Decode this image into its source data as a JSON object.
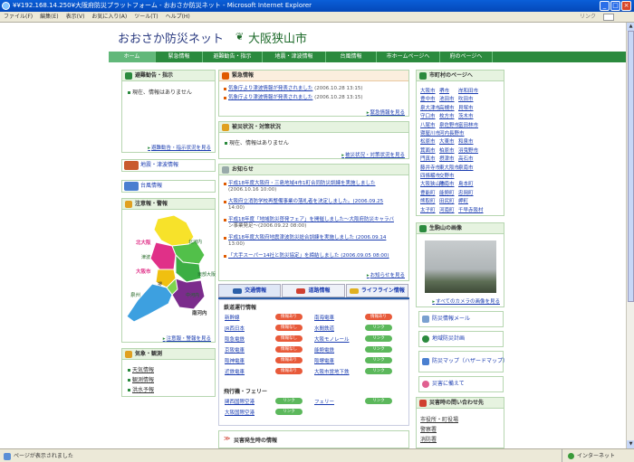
{
  "window": {
    "title": "¥¥192.168.14.250¥大阪府防災プラットフォーム - おおさか防災ネット - Microsoft Internet Explorer"
  },
  "menu": {
    "items": [
      "ファイル(F)",
      "編集(E)",
      "表示(V)",
      "お気に入り(A)",
      "ツール(T)",
      "ヘルプ(H)"
    ],
    "links": "リンク"
  },
  "status": {
    "text": "ページが表示されました",
    "zone": "インターネット"
  },
  "header": {
    "site_title": "おおさか防災ネット",
    "city": "大阪狭山市"
  },
  "nav": [
    "ホーム",
    "緊急情報",
    "避難勧告・指示",
    "地震・津波情報",
    "台風情報",
    "市ホームページへ",
    "府のページへ"
  ],
  "evac": {
    "title": "避難勧告・指示",
    "status": "現在、情報はありません",
    "more": "避難勧告・指示状況を見る"
  },
  "left_buttons": {
    "quake": "地震・津波情報",
    "typhoon": "台風情報"
  },
  "warn": {
    "title": "注意報・警報",
    "more": "注意報・警報を見る",
    "regions": {
      "hokutai": "北大阪",
      "higashi": "東部大阪",
      "kawachi": "北河内",
      "naka": "中河内",
      "minami": "南河内",
      "senshu": "泉州",
      "osaka": "大阪市",
      "sakai": "堺",
      "tsunami": "津波"
    }
  },
  "weather": {
    "title": "気象・観測",
    "items": [
      "天気情報",
      "観測情報",
      "洪水予報"
    ]
  },
  "emergency": {
    "title": "緊急情報",
    "items": [
      {
        "text": "気象庁より津波情報が発表されました",
        "date": "(2006.10.28 13:15)"
      },
      {
        "text": "気象庁より津波情報が発表されました",
        "date": "(2006.10.28 13:15)"
      }
    ],
    "more": "緊急情報を見る"
  },
  "damage": {
    "title": "被災状況・対策状況",
    "status": "現在、情報はありません",
    "more": "被災状況・対策状況を見る"
  },
  "notice": {
    "title": "お知らせ",
    "items": [
      {
        "lines": [
          "平成18年度大阪府・三島地域4市1町合同防災訓練を実施しました",
          "(2006.10.16 10:00)"
        ]
      },
      {
        "lines": [
          "大阪府立消防学校再整備事業の落札者を決定しました。(2006.09.25",
          "14:00)"
        ]
      },
      {
        "lines": [
          "平成18年度「地域防災啓発フェア」を開催しました〜大阪府防災キャラバ",
          "ン事業発足〜(2006.09.22 08:00)"
        ]
      },
      {
        "lines": [
          "平成18年度大阪府地震津波防災総合訓練を実施しました (2006.09.14",
          "13:00)"
        ]
      },
      {
        "lines": [
          "「大手スーパー14社と防災協定」を締結しました (2006.09.05 08:00)"
        ]
      }
    ],
    "more": "お知らせを見る"
  },
  "traffic": {
    "tabs": [
      "交通情報",
      "道路情報",
      "ライフライン情報"
    ],
    "rail_title": "鉄道運行情報",
    "rail_left": [
      {
        "name": "新幹線",
        "badge": "情報あり",
        "state": "red"
      },
      {
        "name": "JR西日本",
        "badge": "情報なし",
        "state": "red"
      },
      {
        "name": "阪急電鉄",
        "badge": "情報なし",
        "state": "red"
      },
      {
        "name": "京阪電車",
        "badge": "情報なし",
        "state": "red"
      },
      {
        "name": "阪神電車",
        "badge": "情報あり",
        "state": "red"
      },
      {
        "name": "近鉄電車",
        "badge": "情報あり",
        "state": "red"
      }
    ],
    "rail_right": [
      {
        "name": "南海電車",
        "badge": "情報あり",
        "state": "red"
      },
      {
        "name": "水間鉄道",
        "badge": "リンク",
        "state": "green"
      },
      {
        "name": "大阪モノレール",
        "badge": "リンク",
        "state": "green"
      },
      {
        "name": "能勢電鉄",
        "badge": "リンク",
        "state": "green"
      },
      {
        "name": "阪堺電車",
        "badge": "リンク",
        "state": "green"
      },
      {
        "name": "大阪市営地下鉄",
        "badge": "リンク",
        "state": "green"
      }
    ],
    "air_title": "飛行機・フェリー",
    "air_left": [
      {
        "name": "関西国際空港",
        "badge": "リンク"
      },
      {
        "name": "大阪国際空港",
        "badge": "リンク"
      }
    ],
    "air_right": [
      {
        "name": "フェリー",
        "badge": "リンク"
      }
    ]
  },
  "disaster_link": "災害発生時の情報",
  "cities": {
    "title": "市町村のページへ",
    "rows": [
      [
        "大阪市",
        "堺市",
        "岸和田市"
      ],
      [
        "豊中市",
        "池田市",
        "吹田市"
      ],
      [
        "泉大津市",
        "高槻市",
        "貝塚市"
      ],
      [
        "守口市",
        "枚方市",
        "茨木市"
      ],
      [
        "八尾市",
        "泉佐野市",
        "富田林市"
      ],
      [
        "寝屋川市",
        "河内長野市",
        ""
      ],
      [
        "松原市",
        "大東市",
        "和泉市"
      ],
      [
        "箕面市",
        "柏原市",
        "羽曳野市"
      ],
      [
        "門真市",
        "摂津市",
        "高石市"
      ],
      [
        "藤井寺市",
        "東大阪市",
        "泉南市"
      ],
      [
        "四條畷市",
        "交野市",
        ""
      ],
      [
        "大阪狭山市",
        "阪南市",
        "島本町"
      ],
      [
        "豊能町",
        "能勢町",
        "忠岡町"
      ],
      [
        "熊取町",
        "田尻町",
        "岬町"
      ],
      [
        "太子町",
        "河南町",
        "千早赤阪村"
      ]
    ]
  },
  "camera": {
    "title": "生駒山の画像",
    "more": "すべてのカメラの画像を見る"
  },
  "right_buttons": [
    "防災情報メール",
    "地域防災計画",
    "防災マップ（ハザードマップ）",
    "災害に備えて"
  ],
  "contact": {
    "title": "災害時の問い合わせ先",
    "items": [
      "市役所・町役場",
      "警察署",
      "消防署"
    ]
  }
}
